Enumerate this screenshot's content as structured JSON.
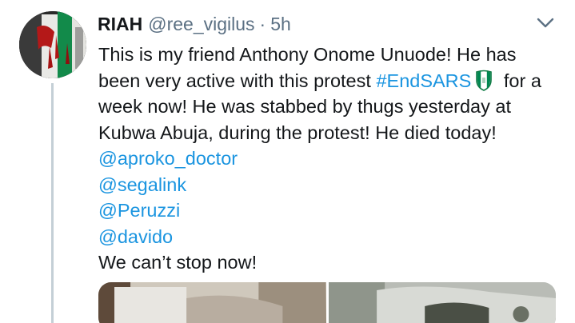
{
  "tweet": {
    "display_name": "RIAH",
    "handle": "@ree_vigilus",
    "separator": "·",
    "time": "5h",
    "menu_icon": "chevron-down-icon",
    "body": {
      "line1": "This is my friend Anthony Onome Unuode! He has",
      "line2_pre": "been very active with this protest ",
      "hashtag": "#EndSARS",
      "hashtag_emoji_icon": "nigeria-flag-shield-icon",
      "line2_post": " for a",
      "line3": "week now! He was stabbed by thugs yesterday at",
      "line4": "Kubwa Abuja, during the protest! He died today!",
      "mentions": [
        "@aproko_doctor",
        "@segalink",
        "@Peruzzi",
        "@davido"
      ],
      "closing": "We can’t stop now!"
    },
    "media_count": 2
  },
  "colors": {
    "text": "#14171a",
    "secondary": "#5b7083",
    "link": "#1b95e0",
    "thread_line": "#c4cfd6",
    "flag_green": "#008751"
  }
}
